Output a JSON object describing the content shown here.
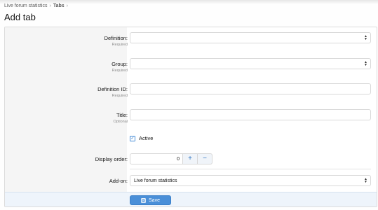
{
  "breadcrumb": {
    "items": [
      "Live forum statistics",
      "Tabs"
    ],
    "separator": "›"
  },
  "page": {
    "title": "Add tab"
  },
  "form": {
    "definition": {
      "label": "Definition:",
      "hint": "Required",
      "value": ""
    },
    "group": {
      "label": "Group:",
      "hint": "Required",
      "value": ""
    },
    "definition_id": {
      "label": "Definition ID:",
      "hint": "Required",
      "value": ""
    },
    "title": {
      "label": "Title:",
      "hint": "Optional",
      "value": ""
    },
    "active": {
      "label": "Active",
      "checked": true
    },
    "display_order": {
      "label": "Display order:",
      "value": "0",
      "plus": "+",
      "minus": "−"
    },
    "addon": {
      "label": "Add-on:",
      "value": "Live forum statistics"
    }
  },
  "footer": {
    "save_label": "Save"
  },
  "colors": {
    "accent": "#4a8fd8",
    "label_bg": "#f5f5f5",
    "footer_bg": "#eef4fb"
  }
}
